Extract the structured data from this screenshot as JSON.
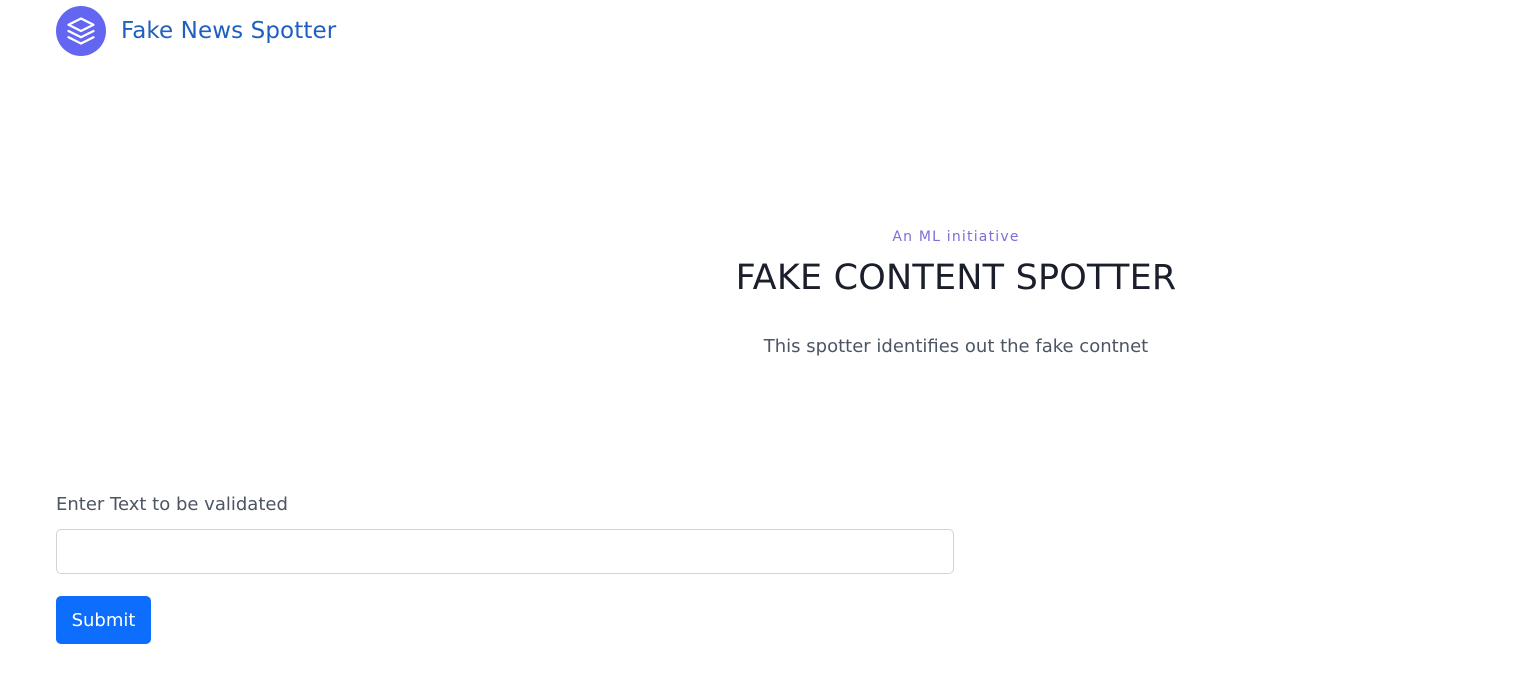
{
  "navbar": {
    "logo_icon": "layers-icon",
    "logo_color": "#6366f1",
    "brand": "Fake News Spotter",
    "brand_color": "#1f5fbf"
  },
  "hero": {
    "eyebrow": "An ML initiative",
    "title": "FAKE CONTENT SPOTTER",
    "subtitle": "This spotter identifies out the fake contnet"
  },
  "form": {
    "label": "Enter Text to be validated",
    "input_value": "",
    "input_placeholder": "",
    "submit_label": "Submit",
    "submit_color": "#0d6efd"
  }
}
